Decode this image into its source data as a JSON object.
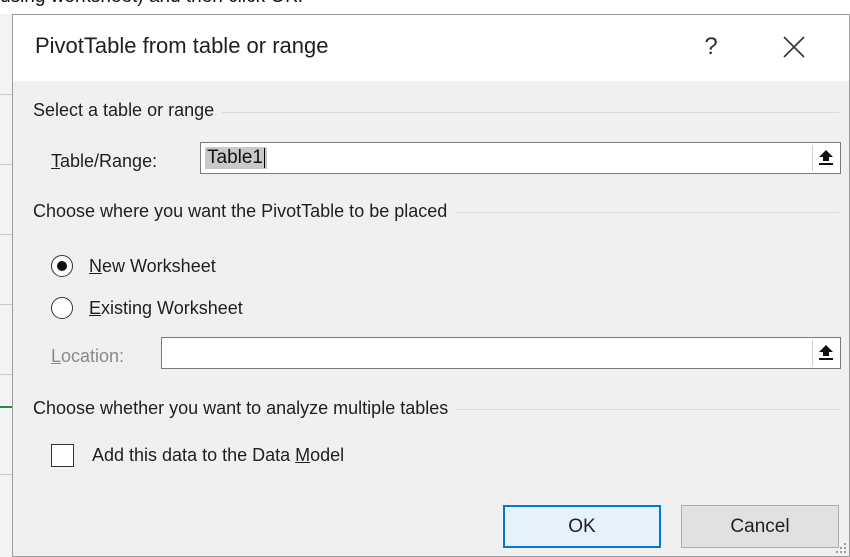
{
  "background": {
    "caption": "using worksheet) and then click OK."
  },
  "dialog": {
    "title": "PivotTable from table or range",
    "help_label": "?",
    "section_select": {
      "label": "Select a table or range",
      "table_range_label": "Table/Range:",
      "table_range_value": "Table1"
    },
    "section_place": {
      "label": "Choose where you want the PivotTable to be placed",
      "options": [
        {
          "label": "New Worksheet",
          "checked": true
        },
        {
          "label": "Existing Worksheet",
          "checked": false
        }
      ],
      "location_label": "Location:",
      "location_value": ""
    },
    "section_multiple": {
      "label": "Choose whether you want to analyze multiple tables",
      "data_model_label": "Add this data to the Data Model",
      "data_model_checked": false
    },
    "buttons": {
      "ok": "OK",
      "cancel": "Cancel"
    }
  },
  "icons": {
    "close": "close-icon",
    "collapse": "collapse-dialog-icon",
    "grip": "resize-grip-icon"
  },
  "colors": {
    "accent": "#0078d7",
    "dialog_bg": "#f0f0f0"
  }
}
